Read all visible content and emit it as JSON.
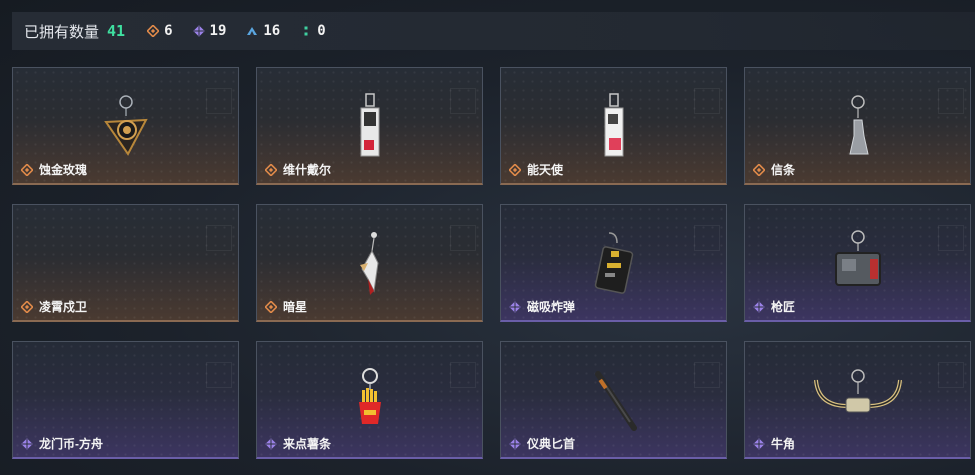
{
  "header": {
    "owned_label": "已拥有数量",
    "owned_count": "41",
    "rarities": [
      {
        "icon": "orange-diamond-icon",
        "value": "6",
        "color": "#e08a4a"
      },
      {
        "icon": "purple-diamond-icon",
        "value": "19",
        "color": "#9b82e8"
      },
      {
        "icon": "blue-triangle-icon",
        "value": "16",
        "color": "#5aa6e0"
      },
      {
        "icon": "green-dots-icon",
        "value": "0",
        "color": "#3fd0a0"
      }
    ]
  },
  "items": [
    {
      "name": "蚀金玫瑰",
      "rarity": "orange",
      "art": "rose-charm"
    },
    {
      "name": "维什戴尔",
      "rarity": "orange",
      "art": "tag-charm"
    },
    {
      "name": "能天使",
      "rarity": "orange",
      "art": "tag-charm-pink"
    },
    {
      "name": "信条",
      "rarity": "orange",
      "art": "figure-charm"
    },
    {
      "name": "凌霄戍卫",
      "rarity": "orange",
      "art": "none"
    },
    {
      "name": "暗星",
      "rarity": "orange",
      "art": "blade-charm"
    },
    {
      "name": "磁吸炸弹",
      "rarity": "purple",
      "art": "bomb-charm"
    },
    {
      "name": "枪匠",
      "rarity": "purple",
      "art": "box-charm"
    },
    {
      "name": "龙门币-方舟",
      "rarity": "purple",
      "art": "none"
    },
    {
      "name": "来点薯条",
      "rarity": "purple",
      "art": "fries-charm"
    },
    {
      "name": "仪典匕首",
      "rarity": "purple",
      "art": "dagger-charm"
    },
    {
      "name": "牛角",
      "rarity": "purple",
      "art": "horn-charm"
    }
  ],
  "colors": {
    "orange": "#e08a4a",
    "purple": "#9b82e8",
    "accent_green": "#3fe0a0"
  }
}
